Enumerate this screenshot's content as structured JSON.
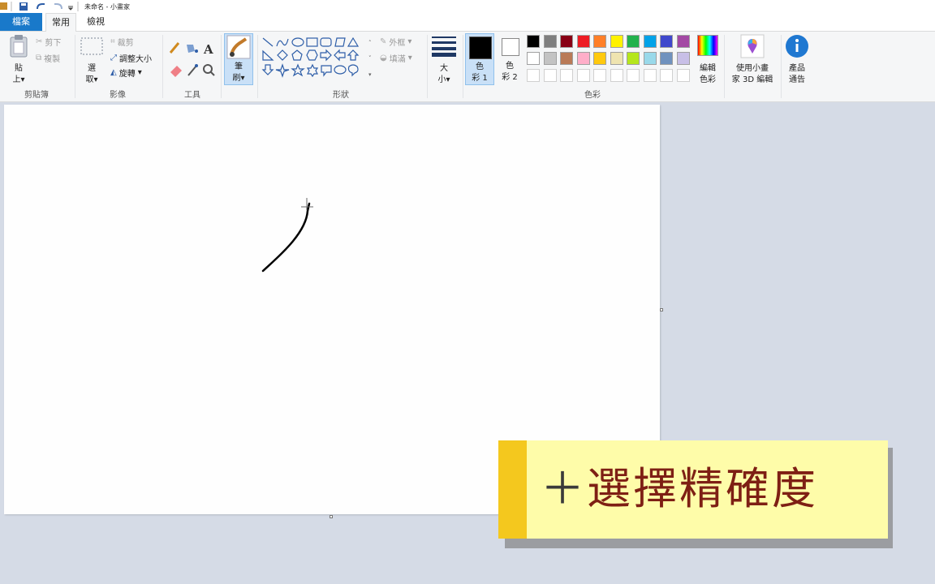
{
  "window": {
    "title": "未命名 - 小畫家"
  },
  "tabs": {
    "file": "檔案",
    "home": "常用",
    "view": "檢視"
  },
  "clipboard": {
    "paste": "貼",
    "paste2": "上",
    "cut": "剪下",
    "copy": "複製",
    "label": "剪貼簿"
  },
  "image": {
    "select": "選",
    "select2": "取",
    "crop": "裁剪",
    "resize": "調整大小",
    "rotate": "旋轉",
    "label": "影像"
  },
  "tools": {
    "label": "工具"
  },
  "brushes": {
    "label": "筆",
    "label2": "刷"
  },
  "shapes": {
    "outline": "外框",
    "fill": "填滿",
    "label": "形狀"
  },
  "size": {
    "label": "大",
    "label2": "小"
  },
  "colors": {
    "color1": "色",
    "color1b": "彩 1",
    "color2": "色",
    "color2b": "彩 2",
    "edit": "編輯",
    "edit2": "色彩",
    "label": "色彩",
    "palette_row1": [
      "#000000",
      "#7f7f7f",
      "#880015",
      "#ed1c24",
      "#ff7f27",
      "#fff200",
      "#22b14c",
      "#00a2e8",
      "#3f48cc",
      "#a349a4"
    ],
    "palette_row2": [
      "#ffffff",
      "#c3c3c3",
      "#b97a57",
      "#ffaec9",
      "#ffc90e",
      "#efe4b0",
      "#b5e61d",
      "#99d9ea",
      "#7092be",
      "#c8bfe7"
    ]
  },
  "paint3d": {
    "label": "使用小畫",
    "label2": "家 3D 編輯"
  },
  "product": {
    "label": "產品",
    "label2": "通告"
  },
  "caption": {
    "plus": "＋",
    "text": "選擇精確度"
  }
}
